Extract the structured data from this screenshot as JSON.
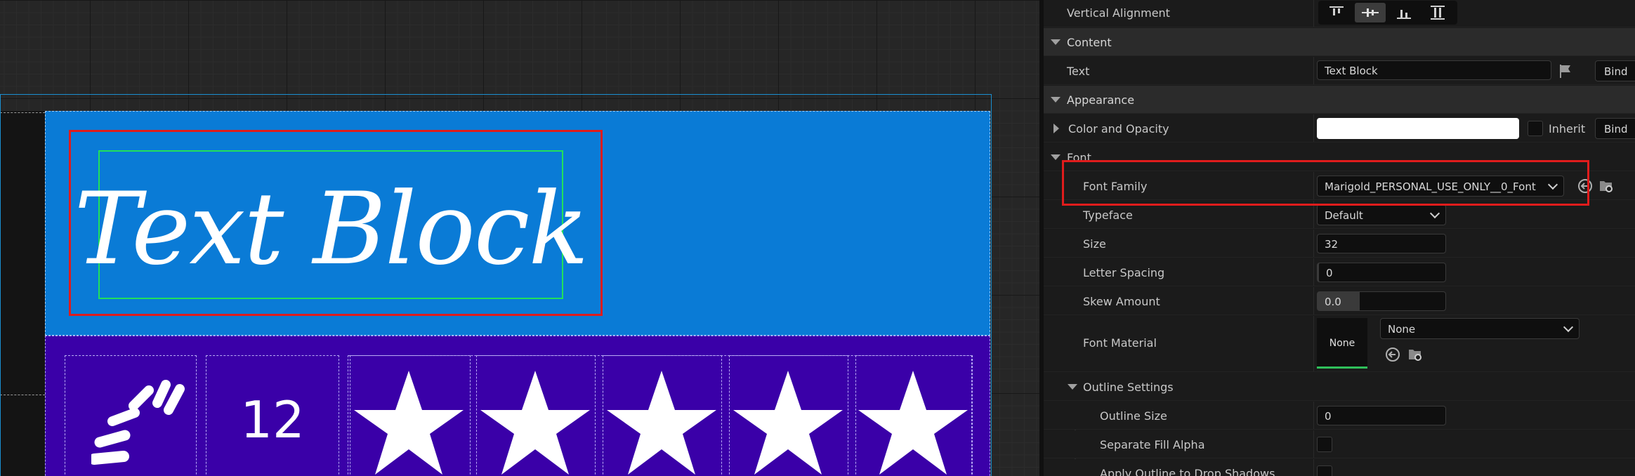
{
  "viewport": {
    "canvas_text": "Text Block",
    "count_text": "12",
    "star_count": 5,
    "colors": {
      "top_panel": "#0a7bd6",
      "bottom_panel": "#3a00a8",
      "selection": "#e01c1c",
      "text_bounds": "#22e05a"
    }
  },
  "details": {
    "vertical_alignment": {
      "label": "Vertical Alignment",
      "options": [
        "align-top-icon",
        "align-center-icon",
        "align-bottom-icon",
        "align-fill-icon"
      ],
      "selected_index": 1
    },
    "content": {
      "category": "Content",
      "text_label": "Text",
      "text_value": "Text Block",
      "bind_label": "Bind"
    },
    "appearance": {
      "category": "Appearance",
      "color_label": "Color and Opacity",
      "inherit_label": "Inherit",
      "bind_label": "Bind",
      "color_value": "#ffffff"
    },
    "font": {
      "group_label": "Font",
      "family_label": "Font Family",
      "family_value": "Marigold_PERSONAL_USE_ONLY__0_Font",
      "typeface_label": "Typeface",
      "typeface_value": "Default",
      "size_label": "Size",
      "size_value": "32",
      "letter_spacing_label": "Letter Spacing",
      "letter_spacing_value": "0",
      "skew_label": "Skew Amount",
      "skew_value": "0.0",
      "material_label": "Font Material",
      "material_thumb": "None",
      "material_value": "None",
      "outline": {
        "group_label": "Outline Settings",
        "size_label": "Outline Size",
        "size_value": "0",
        "separate_alpha_label": "Separate Fill Alpha",
        "apply_shadows_label": "Apply Outline to Drop Shadows"
      }
    }
  }
}
